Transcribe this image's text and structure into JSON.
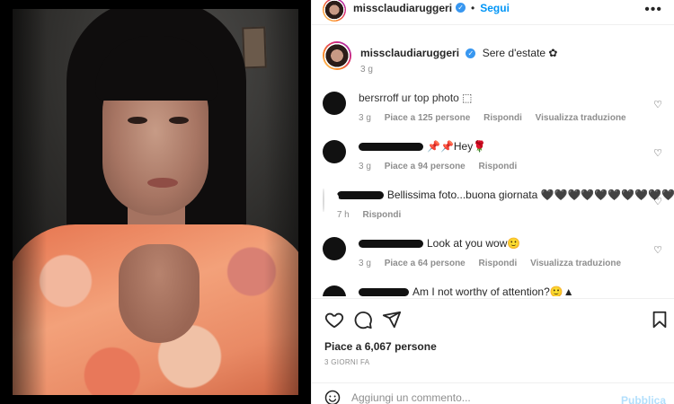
{
  "post": {
    "author": "missclaudiaruggeri",
    "follow_label": "Segui",
    "separator": "•",
    "more_label": "•••"
  },
  "caption": {
    "author": "missclaudiaruggeri",
    "text": "Sere d'estate ✿",
    "time": "3 g"
  },
  "comments": [
    {
      "visible_text": "bersrroff ur top photo ⬚",
      "time": "3 g",
      "likes": "Piace a 125 persone",
      "reply": "Rispondi",
      "translate": "Visualizza traduzione"
    },
    {
      "visible_text": "📌📌Hey🌹",
      "time": "3 g",
      "likes": "Piace a 94 persone",
      "reply": "Rispondi"
    },
    {
      "visible_text": "Bellissima foto...buona giornata 🖤🖤🖤🖤🖤🖤🖤🖤🖤🖤",
      "time": "7 h",
      "reply": "Rispondi"
    },
    {
      "visible_text": "Look at you wow🙂",
      "time": "3 g",
      "likes": "Piace a 64 persone",
      "reply": "Rispondi",
      "translate": "Visualizza traduzione"
    },
    {
      "visible_text": "Am I not worthy of attention?🙂▲"
    }
  ],
  "stats": {
    "likes": "Piace a 6,067 persone",
    "date": "3 GIORNI FA"
  },
  "composer": {
    "placeholder": "Aggiungi un commento...",
    "publish_label": "Pubblica"
  },
  "icons": [
    "heart-icon",
    "comment-icon",
    "share-icon",
    "bookmark-icon",
    "emoji-icon",
    "more-icon",
    "verified-icon"
  ],
  "colors": {
    "accent": "#0095f6",
    "publish_disabled": "#b2dffc",
    "muted": "#8e8e8e",
    "verified": "#3897f0"
  }
}
